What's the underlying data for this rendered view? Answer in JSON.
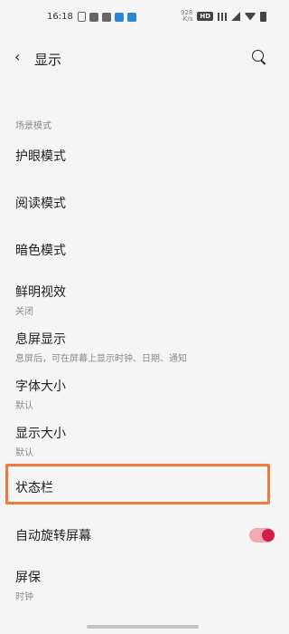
{
  "status_bar": {
    "time": "16:18",
    "net_speed": "928",
    "net_unit": "K/s",
    "hd_label": "HD",
    "accent": "#2a87d8"
  },
  "header": {
    "title": "显示",
    "back_icon": "back-arrow-icon",
    "search_icon": "search-icon"
  },
  "section_label": "场景模式",
  "items": [
    {
      "label": "护眼模式"
    },
    {
      "label": "阅读模式"
    },
    {
      "label": "暗色模式"
    },
    {
      "label": "鲜明视效",
      "sub": "关闭"
    },
    {
      "label": "息屏显示",
      "sub": "息屏后，可在屏幕上显示时钟、日期、通知"
    },
    {
      "label": "字体大小",
      "sub": "默认"
    },
    {
      "label": "显示大小",
      "sub": "默认"
    },
    {
      "label": "状态栏"
    },
    {
      "label": "自动旋转屏幕",
      "toggle": true
    },
    {
      "label": "屏保",
      "sub": "时钟"
    }
  ],
  "toggle_on_color": "#d31e4a",
  "highlight_color": "#f0793c"
}
